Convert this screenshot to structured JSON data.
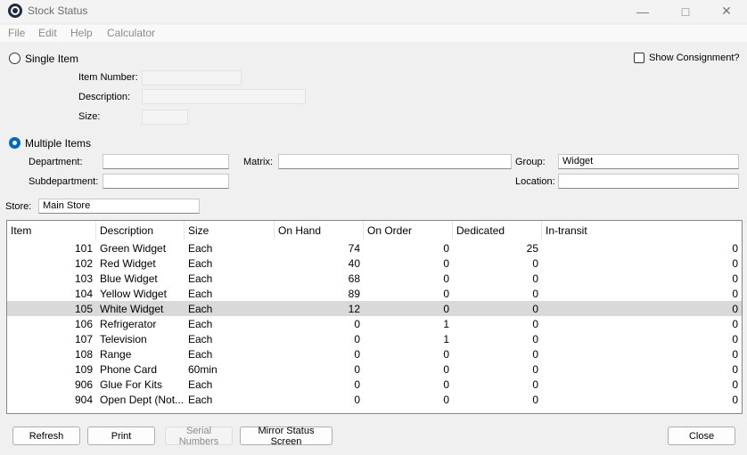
{
  "window": {
    "title": "Stock Status",
    "minimize_glyph": "—",
    "maximize_glyph": "□",
    "close_glyph": "✕",
    "icon": "app-logo-icon"
  },
  "menu": [
    "File",
    "Edit",
    "Help",
    "Calculator"
  ],
  "single_item": {
    "label": "Single Item",
    "selected": false,
    "item_number_label": "Item Number:",
    "item_number_value": "",
    "description_label": "Description:",
    "description_value": "",
    "size_label": "Size:",
    "size_value": ""
  },
  "show_consignment": {
    "label": "Show Consignment?",
    "checked": false
  },
  "multiple_items": {
    "label": "Multiple Items",
    "selected": true,
    "department_label": "Department:",
    "department_value": "",
    "subdepartment_label": "Subdepartment:",
    "subdepartment_value": "",
    "matrix_label": "Matrix:",
    "matrix_value": "",
    "group_label": "Group:",
    "group_value": "Widget",
    "location_label": "Location:",
    "location_value": ""
  },
  "store": {
    "label": "Store:",
    "value": "Main Store"
  },
  "grid": {
    "columns": [
      "Item",
      "Description",
      "Size",
      "On Hand",
      "On Order",
      "Dedicated",
      "In-transit"
    ],
    "rows": [
      [
        "101",
        "Green Widget",
        "Each",
        "74",
        "0",
        "25",
        "0"
      ],
      [
        "102",
        "Red Widget",
        "Each",
        "40",
        "0",
        "0",
        "0"
      ],
      [
        "103",
        "Blue Widget",
        "Each",
        "68",
        "0",
        "0",
        "0"
      ],
      [
        "104",
        "Yellow Widget",
        "Each",
        "89",
        "0",
        "0",
        "0"
      ],
      [
        "105",
        "White Widget",
        "Each",
        "12",
        "0",
        "0",
        "0"
      ],
      [
        "106",
        "Refrigerator",
        "Each",
        "0",
        "1",
        "0",
        "0"
      ],
      [
        "107",
        "Television",
        "Each",
        "0",
        "1",
        "0",
        "0"
      ],
      [
        "108",
        "Range",
        "Each",
        "0",
        "0",
        "0",
        "0"
      ],
      [
        "109",
        "Phone Card",
        "60min",
        "0",
        "0",
        "0",
        "0"
      ],
      [
        "906",
        "Glue For Kits",
        "Each",
        "0",
        "0",
        "0",
        "0"
      ],
      [
        "904",
        "Open Dept (Not...",
        "Each",
        "0",
        "0",
        "0",
        "0"
      ]
    ],
    "selected_row": 4
  },
  "buttons": {
    "refresh": "Refresh",
    "print": "Print",
    "serial_numbers": "Serial Numbers",
    "mirror_status": "Mirror Status Screen",
    "close": "Close"
  },
  "colors": {
    "accent": "#0067c0",
    "selection": "#d9d9d9"
  }
}
